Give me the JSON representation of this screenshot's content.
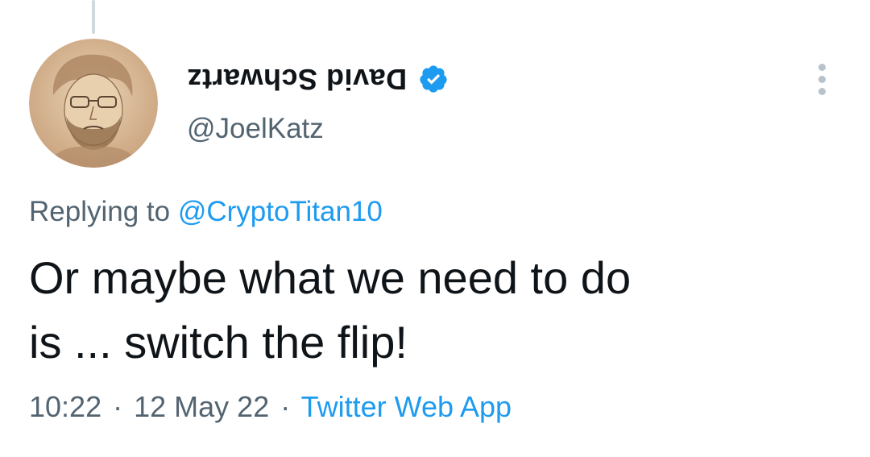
{
  "author": {
    "display_name": "David Schwartz",
    "handle": "@JoelKatz",
    "verified": true,
    "avatar_icon": "sketch-portrait-avatar"
  },
  "reply": {
    "prefix": "Replying to ",
    "mention": "@CryptoTitan10"
  },
  "tweet": {
    "line1": "Or maybe what we need to do",
    "line2": "is ... switch the flip!"
  },
  "meta": {
    "time": "10:22",
    "separator": "·",
    "date": "12 May 22",
    "source": "Twitter Web App"
  },
  "colors": {
    "accent": "#1d9bf0",
    "secondary_text": "#536471",
    "primary_text": "#0f1419",
    "thread_line": "#cfd9de"
  }
}
